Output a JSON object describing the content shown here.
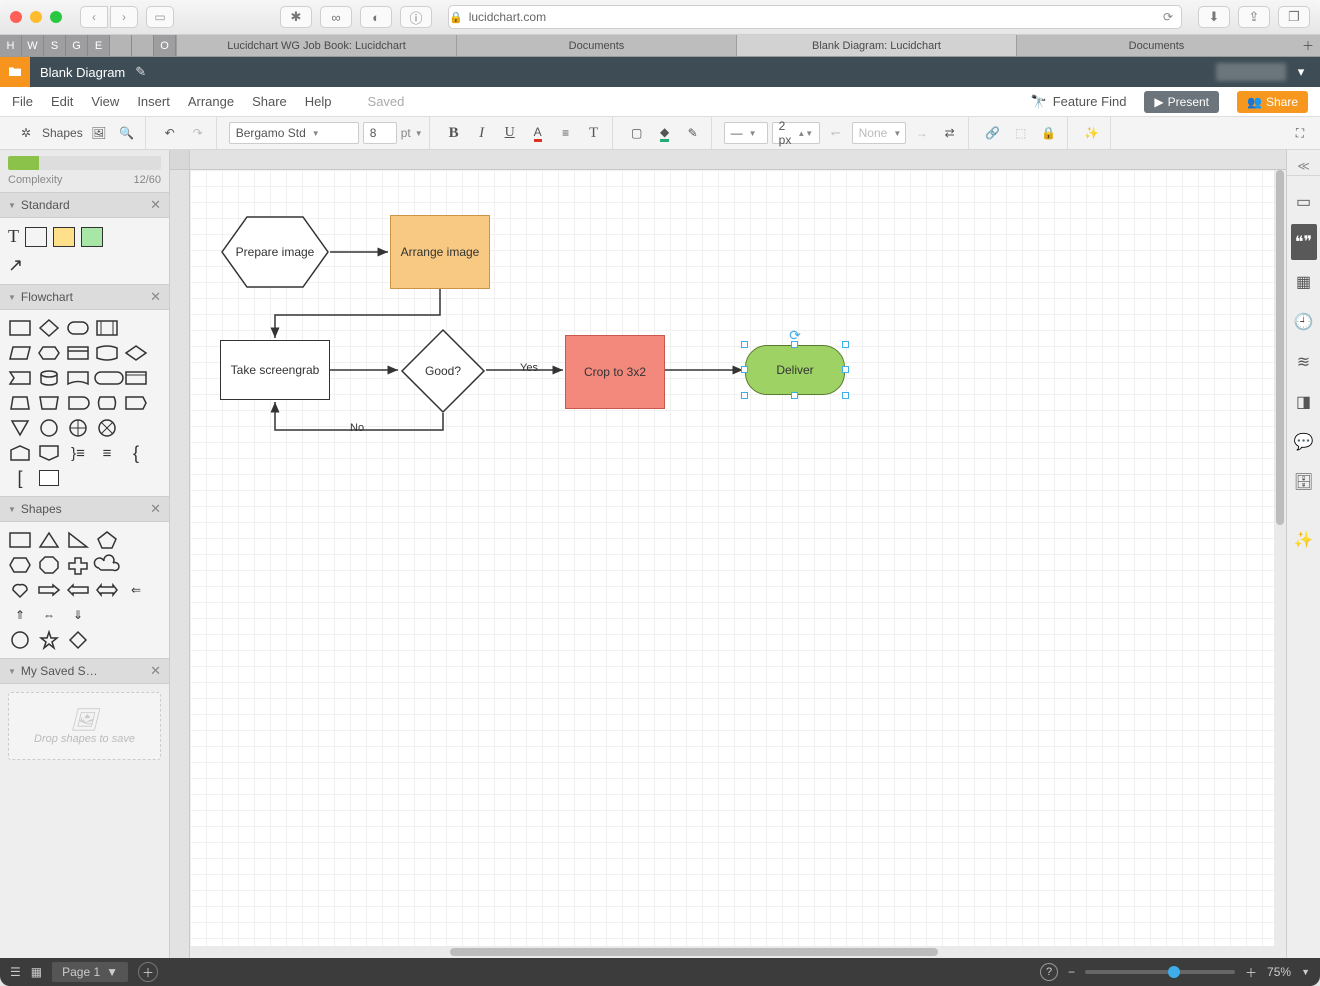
{
  "browser": {
    "url_host": "lucidchart.com",
    "pinned": [
      "H",
      "W",
      "S",
      "G",
      "E"
    ],
    "tabs": [
      {
        "label": "Lucidchart WG Job Book: Lucidchart",
        "active": false
      },
      {
        "label": "Documents",
        "active": false
      },
      {
        "label": "Blank Diagram: Lucidchart",
        "active": true
      },
      {
        "label": "Documents",
        "active": false
      }
    ]
  },
  "app": {
    "doc_title": "Blank Diagram",
    "menus": [
      "File",
      "Edit",
      "View",
      "Insert",
      "Arrange",
      "Share",
      "Help"
    ],
    "save_status": "Saved",
    "feature_find": "Feature Find",
    "present": "Present",
    "share": "Share"
  },
  "toolbar": {
    "shapes_label": "Shapes",
    "font_family": "Bergamo Std",
    "font_size": "8",
    "font_unit": "pt",
    "line_width": "2 px",
    "line_end": "None"
  },
  "complexity": {
    "label": "Complexity",
    "value": "12/60",
    "pct": 20
  },
  "panels": {
    "standard": "Standard",
    "flowchart": "Flowchart",
    "shapes": "Shapes",
    "saved": "My Saved S…",
    "drop_hint": "Drop shapes to save"
  },
  "flow": {
    "prepare": "Prepare image",
    "arrange": "Arrange image",
    "screengrab": "Take screengrab",
    "good": "Good?",
    "yes": "Yes",
    "no": "No",
    "crop": "Crop to 3x2",
    "deliver": "Deliver"
  },
  "footer": {
    "page_label": "Page 1",
    "zoom": "75%"
  }
}
